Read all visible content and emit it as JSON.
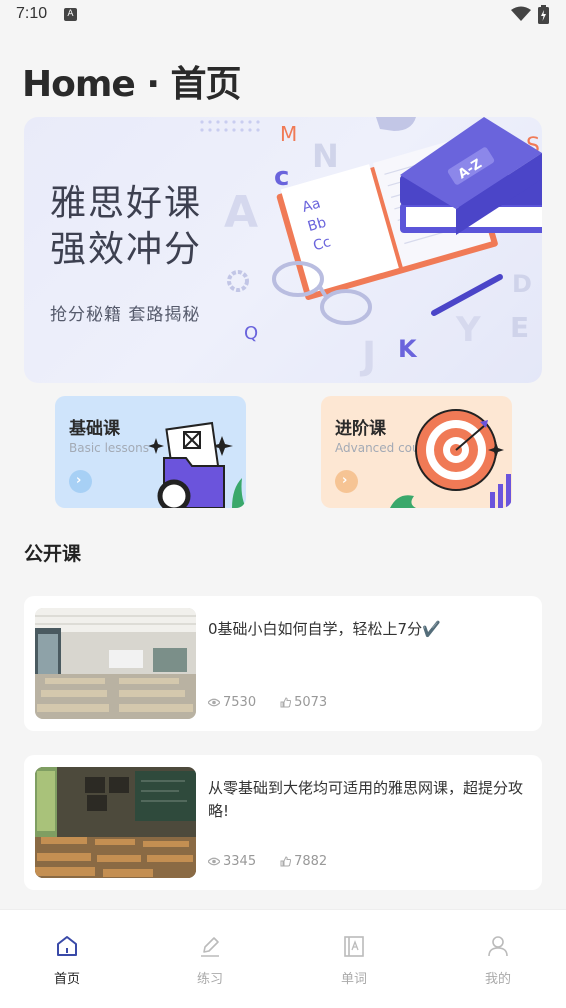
{
  "status_bar": {
    "time": "7:10",
    "notif_glyph": "A"
  },
  "page_title": "Home · 首页",
  "hero": {
    "title": "雅思好课\n强效冲分",
    "subtitle": "抢分秘籍  套路揭秘",
    "book_label": "A-Z",
    "page_letters": [
      "Aa",
      "Bb",
      "Cc"
    ],
    "floating_letters": [
      "A",
      "c",
      "N",
      "M",
      "S",
      "D",
      "Y",
      "E",
      "J",
      "K",
      "Q"
    ],
    "colors": {
      "book": "#5b55d9",
      "accent": "#f07a56"
    }
  },
  "categories": [
    {
      "title": "基础课",
      "subtitle": "Basic lessons",
      "icon": "folder-icon"
    },
    {
      "title": "进阶课",
      "subtitle": "Advanced course",
      "icon": "target-icon"
    }
  ],
  "section_title": "公开课",
  "courses": [
    {
      "title": "0基础小白如何自学，轻松上7分✔️",
      "views": "7530",
      "likes": "5073",
      "thumb": "classroom-image"
    },
    {
      "title": "从零基础到大佬均可适用的雅思网课，超提分攻略!",
      "views": "3345",
      "likes": "7882",
      "thumb": "classroom-image"
    }
  ],
  "nav": [
    {
      "label": "首页",
      "icon": "home-icon",
      "active": true
    },
    {
      "label": "练习",
      "icon": "pencil-icon",
      "active": false
    },
    {
      "label": "单词",
      "icon": "book-icon",
      "active": false
    },
    {
      "label": "我的",
      "icon": "user-icon",
      "active": false
    }
  ]
}
